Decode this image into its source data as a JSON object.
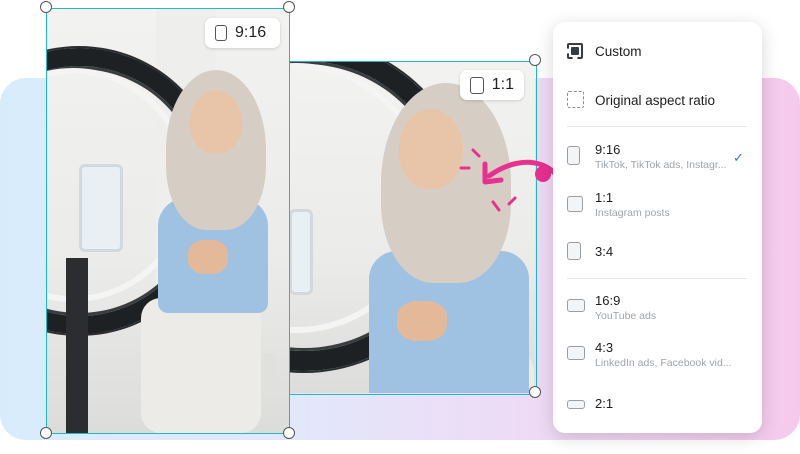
{
  "colors": {
    "selection_frame": "#1fb9c6",
    "accent_arrow": "#e8308f",
    "check_blue": "#2f78e6"
  },
  "canvas": {
    "badge_916": "9:16",
    "badge_11": "1:1"
  },
  "dropdown": {
    "custom_label": "Custom",
    "original_label": "Original aspect ratio",
    "options": [
      {
        "ratio": "9:16",
        "desc": "TikTok, TikTok ads, Instagr...",
        "selected": true
      },
      {
        "ratio": "1:1",
        "desc": "Instagram posts",
        "selected": false
      },
      {
        "ratio": "3:4",
        "desc": "",
        "selected": false
      },
      {
        "ratio": "16:9",
        "desc": "YouTube ads",
        "selected": false
      },
      {
        "ratio": "4:3",
        "desc": "LinkedIn ads, Facebook vid...",
        "selected": false
      },
      {
        "ratio": "2:1",
        "desc": "",
        "selected": false
      }
    ],
    "check_icon": "✓"
  }
}
